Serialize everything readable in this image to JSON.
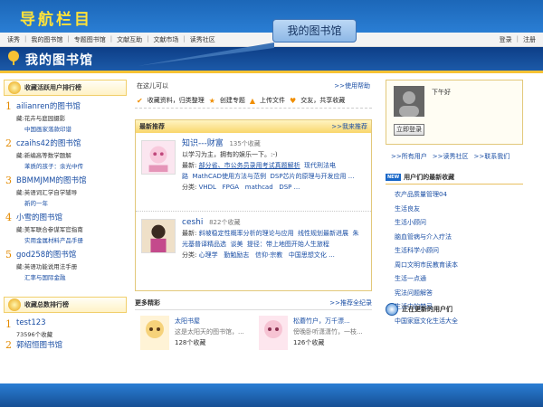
{
  "banner": {
    "title": "导航栏目"
  },
  "callout": {
    "text": "我的图书馆"
  },
  "nav": {
    "left": [
      "读秀",
      "我的图书馆",
      "专题图书馆",
      "文献互助",
      "文献市场",
      "读秀社区"
    ],
    "right": [
      "登录",
      "注册"
    ]
  },
  "header": {
    "title": "我的图书馆"
  },
  "left_panel": {
    "active_heading": "收藏活跃用户排行榜",
    "active_users": [
      {
        "rank": "1",
        "name": "ailianren的图书馆",
        "line1": "藏:花卉与庭园摄影",
        "line2": "中国画家落款印谱"
      },
      {
        "rank": "2",
        "name": "czaihs42的图书馆",
        "line1": "藏:新编高等数学题解",
        "line2": "苯质的孩子：余光中传"
      },
      {
        "rank": "3",
        "name": "BBMMJMM的图书馆",
        "line1": "藏:英语词汇学自学辅导",
        "line2": "新的一年"
      },
      {
        "rank": "4",
        "name": "小雪的图书馆",
        "line1": "藏:美军联合参谋军官指南",
        "line2": "实用金属材料产品手册"
      },
      {
        "rank": "5",
        "name": "god258的图书馆",
        "line1": "藏:英语功能说用法手册",
        "line2": "汇率与国际金融"
      }
    ],
    "total_heading": "收藏总数排行榜",
    "total_users": [
      {
        "rank": "1",
        "name": "test123",
        "count": "73596个收藏"
      },
      {
        "rank": "2",
        "name": "郭绍恒图书馆",
        "count": ""
      }
    ]
  },
  "middle": {
    "tool_label": "在这儿可以",
    "help_link": ">>使用帮助",
    "actions": [
      "收藏资料，归类整理",
      "创建专题",
      "上传文件",
      "交友，共享收藏"
    ],
    "rec_heading": "最新推荐",
    "rec_more": ">>我来推荐",
    "recs": [
      {
        "title": "知识---财富",
        "count": "135个收藏",
        "motto": "以学习为主，拥有的娱乐一下。:-)",
        "latest_label": "最新:",
        "latest": "部分省、市公务员录用考试真题解析",
        "latest2": "现代刑法电",
        "latest3": "路",
        "latest4": "MathCAD使用方法与范例",
        "latest5": "DSP芯片的原理与开发应用 ...",
        "cat_label": "分类:",
        "cats": [
          "VHDL",
          "FPGA",
          "mathcad",
          "DSP ..."
        ]
      },
      {
        "title": "ceshi",
        "count": "822个收藏",
        "latest_label": "最新:",
        "latest": "斜坡稳定性概率分析的理论与应用",
        "latest2": "线性规划最新进展",
        "latest3": "朱",
        "latest4": "光基普译精品选",
        "latest5": "谈美",
        "latest6": "提径：带上地图开始人生旅程",
        "cat_label": "分类:",
        "cats": [
          "心理学",
          "勤勉励志",
          "信仰·宗教",
          "中国思想文化 ..."
        ]
      }
    ],
    "more_heading": "更多精彩",
    "more_link": ">>推荐全纪录",
    "more_items": [
      {
        "title": "太阳书屋",
        "desc": "这是太阳天的图书馆，...",
        "count": "128个收藏"
      },
      {
        "title": "松蘑竹户，万千漂...",
        "desc": "傍晚卧听潇潇竹，一枝...",
        "count": "126个收藏"
      }
    ]
  },
  "right": {
    "greeting": "下午好",
    "login_button": "立即登录",
    "quick_links": [
      ">>所有用户",
      ">>读秀社区",
      ">>联系我们"
    ],
    "new_tag": "NEW",
    "new_heading": "用户们的最新收藏",
    "new_items": [
      "农产品质量管理04",
      "生活良友",
      "生活小顾问",
      "脑血管病与介入疗法",
      "生活科学小顾问",
      "周口文明市民教育读本",
      "生活一点通",
      "宪法问题解答",
      "生活中的禁忌",
      "中国家庭文化生活大全"
    ],
    "updated_heading": "正在更新的用户们"
  }
}
